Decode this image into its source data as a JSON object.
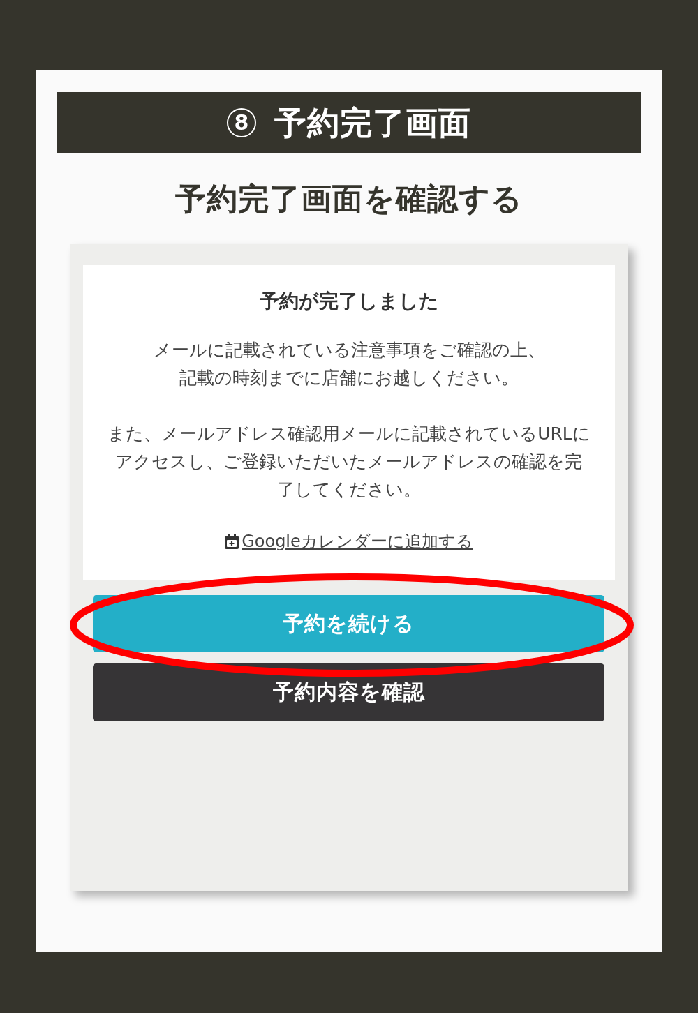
{
  "header": {
    "step": "8",
    "title": "予約完了画面"
  },
  "subtitle": "予約完了画面を確認する",
  "confirmation": {
    "title": "予約が完了しました",
    "paragraphs": [
      {
        "lines": [
          "メールに記載されている注意事項をご確認の上、",
          "記載の時刻までに店舗にお越しください。"
        ]
      },
      {
        "lines": [
          "また、メールアドレス確認用メールに記載されているURLに",
          "アクセスし、ご登録いただいたメールアドレスの確認を完",
          "了してください。"
        ]
      }
    ],
    "link": "Googleカレンダーに追加する"
  },
  "buttons": [
    {
      "label": "予約を続ける",
      "kind": "primary",
      "highlighted": true
    },
    {
      "label": "予約内容を確認",
      "kind": "secondary",
      "highlighted": false
    }
  ]
}
